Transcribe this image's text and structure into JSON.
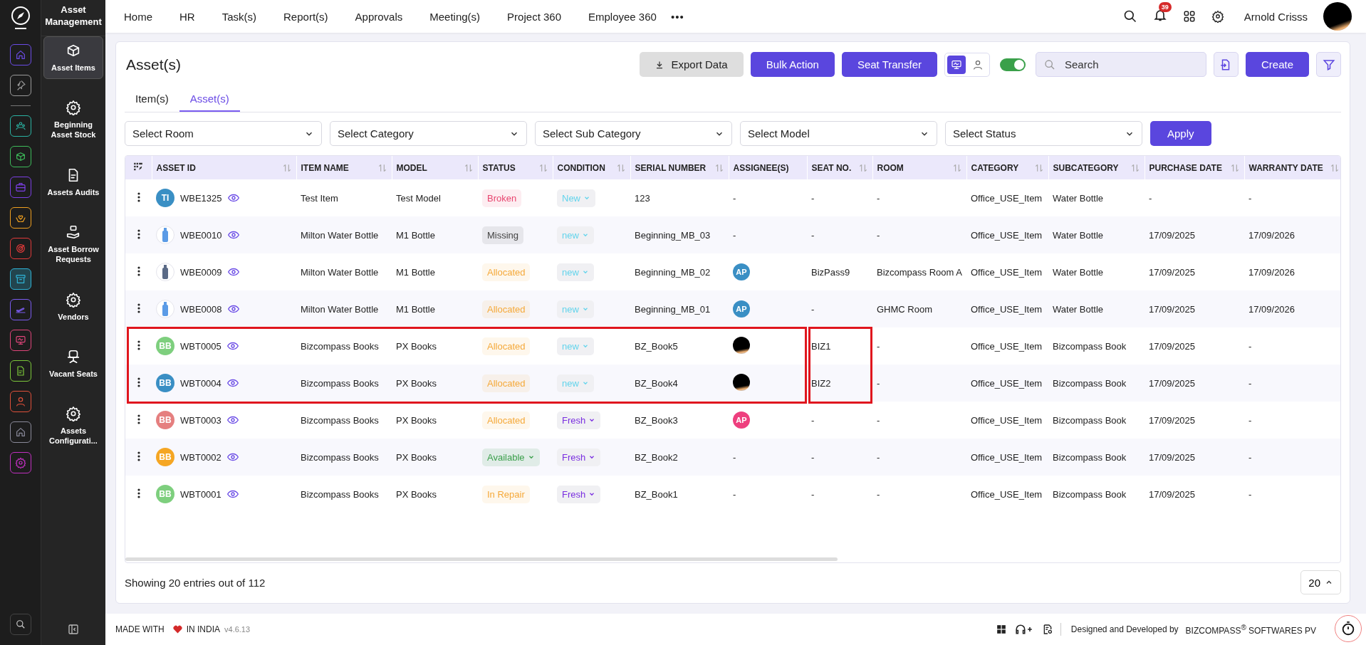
{
  "rail": {
    "pinned": [
      {
        "kind": "home",
        "color": "#6b4ce6",
        "selected": false
      },
      {
        "kind": "pin",
        "color": "#9a9a9a",
        "selected": false
      }
    ],
    "apps": [
      {
        "kind": "people",
        "color": "#2bb3a3",
        "selected": false
      },
      {
        "kind": "box",
        "color": "#3dbb5a",
        "selected": false
      },
      {
        "kind": "briefcase",
        "color": "#7b3fe4",
        "selected": false
      },
      {
        "kind": "hands",
        "color": "#f0a020",
        "selected": false
      },
      {
        "kind": "target",
        "color": "#e03a3a",
        "selected": false
      },
      {
        "kind": "archive",
        "color": "#2fb3d6",
        "selected": true
      },
      {
        "kind": "plane",
        "color": "#7b5cf0",
        "selected": false
      },
      {
        "kind": "monitor",
        "color": "#e0457a",
        "selected": false
      },
      {
        "kind": "document",
        "color": "#7cc83a",
        "selected": false
      },
      {
        "kind": "person",
        "color": "#e0503a",
        "selected": false
      },
      {
        "kind": "house",
        "color": "#8a8a9a",
        "selected": false
      },
      {
        "kind": "gear",
        "color": "#c030c0",
        "selected": false
      }
    ]
  },
  "sidebar": {
    "title": "Asset Management",
    "items": [
      {
        "label": "Asset Items",
        "kind": "box",
        "selected": true
      },
      {
        "label": "Beginning Asset Stock",
        "kind": "gear",
        "selected": false
      },
      {
        "label": "Assets Audits",
        "kind": "audit",
        "selected": false
      },
      {
        "label": "Asset Borrow Requests",
        "kind": "borrow",
        "selected": false
      },
      {
        "label": "Vendors",
        "kind": "gear",
        "selected": false
      },
      {
        "label": "Vacant Seats",
        "kind": "chair",
        "selected": false
      },
      {
        "label": "Assets Configurati...",
        "kind": "gear",
        "selected": false
      }
    ]
  },
  "nav": {
    "items": [
      "Home",
      "HR",
      "Task(s)",
      "Report(s)",
      "Approvals",
      "Meeting(s)",
      "Project 360",
      "Employee 360"
    ],
    "more": "•••",
    "notifications": "39",
    "user": "Arnold Crisss"
  },
  "page": {
    "title": "Asset(s)",
    "export": "Export Data",
    "bulk": "Bulk Action",
    "seat_transfer": "Seat Transfer",
    "views": [
      {
        "kind": "devices",
        "selected": true
      },
      {
        "kind": "person",
        "selected": false
      }
    ],
    "switch_on": true,
    "search": {
      "placeholder": "Search"
    },
    "create": "Create"
  },
  "tabs": [
    {
      "label": "Item(s)",
      "selected": false
    },
    {
      "label": "Asset(s)",
      "selected": true
    }
  ],
  "filters": [
    "Select Room",
    "Select Category",
    "Select Sub Category",
    "Select Model",
    "Select Status"
  ],
  "apply": "Apply",
  "table": {
    "columns": [
      {
        "label": "ASSET ID",
        "sortable": true
      },
      {
        "label": "ITEM NAME",
        "sortable": true
      },
      {
        "label": "MODEL",
        "sortable": true
      },
      {
        "label": "STATUS",
        "sortable": true
      },
      {
        "label": "CONDITION",
        "sortable": true
      },
      {
        "label": "SERIAL NUMBER",
        "sortable": true
      },
      {
        "label": "ASSIGNEE(S)",
        "sortable": false
      },
      {
        "label": "SEAT NO.",
        "sortable": true
      },
      {
        "label": "ROOM",
        "sortable": true
      },
      {
        "label": "CATEGORY",
        "sortable": true
      },
      {
        "label": "SUBCATEGORY",
        "sortable": true
      },
      {
        "label": "PURCHASE DATE",
        "sortable": true
      },
      {
        "label": "WARRANTY DATE",
        "sortable": true
      }
    ],
    "rows": [
      {
        "avatar": {
          "kind": "initials",
          "text": "TI",
          "color": "#3a8fc4"
        },
        "asset_id": "WBE1325",
        "item_name": "Test Item",
        "model": "Test Model",
        "status": {
          "label": "Broken",
          "color": "#e8446e",
          "kind": "label"
        },
        "condition": {
          "label": "New",
          "color": "#63d4ec"
        },
        "serial": "123",
        "assignee": {
          "kind": "none",
          "text": "-"
        },
        "seat": "-",
        "room": "-",
        "category": "Office_USE_Item",
        "subcategory": "Water Bottle",
        "purchase": "-",
        "warranty": "-"
      },
      {
        "avatar": {
          "kind": "bottle",
          "color": "#5b9be6"
        },
        "asset_id": "WBE0010",
        "item_name": "Milton Water Bottle",
        "model": "M1 Bottle",
        "status": {
          "label": "Missing",
          "color": "#444444",
          "kind": "label"
        },
        "condition": {
          "label": "new",
          "color": "#63d4ec"
        },
        "serial": "Beginning_MB_03",
        "assignee": {
          "kind": "none",
          "text": "-"
        },
        "seat": "-",
        "room": "-",
        "category": "Office_USE_Item",
        "subcategory": "Water Bottle",
        "purchase": "17/09/2025",
        "warranty": "17/09/2026"
      },
      {
        "avatar": {
          "kind": "bottle",
          "color": "#5a6a86"
        },
        "asset_id": "WBE0009",
        "item_name": "Milton Water Bottle",
        "model": "M1 Bottle",
        "status": {
          "label": "Allocated",
          "color": "#f5a93a",
          "kind": "label"
        },
        "condition": {
          "label": "new",
          "color": "#63d4ec"
        },
        "serial": "Beginning_MB_02",
        "assignee": {
          "kind": "initials",
          "text": "AP",
          "color": "#3a8fc4"
        },
        "seat": "BizPass9",
        "room": "Bizcompass Room A",
        "category": "Office_USE_Item",
        "subcategory": "Water Bottle",
        "purchase": "17/09/2025",
        "warranty": "17/09/2026"
      },
      {
        "avatar": {
          "kind": "bottle",
          "color": "#5b9be6"
        },
        "asset_id": "WBE0008",
        "item_name": "Milton Water Bottle",
        "model": "M1 Bottle",
        "status": {
          "label": "Allocated",
          "color": "#f5a93a",
          "kind": "label"
        },
        "condition": {
          "label": "new",
          "color": "#63d4ec"
        },
        "serial": "Beginning_MB_01",
        "assignee": {
          "kind": "initials",
          "text": "AP",
          "color": "#3a8fc4"
        },
        "seat": "-",
        "room": "GHMC Room",
        "category": "Office_USE_Item",
        "subcategory": "Water Bottle",
        "purchase": "17/09/2025",
        "warranty": "17/09/2026"
      },
      {
        "avatar": {
          "kind": "initials",
          "text": "BB",
          "color": "#7ecf7e"
        },
        "asset_id": "WBT0005",
        "item_name": "Bizcompass Books",
        "model": "PX Books",
        "status": {
          "label": "Allocated",
          "color": "#f5a93a",
          "kind": "label"
        },
        "condition": {
          "label": "new",
          "color": "#63d4ec"
        },
        "serial": "BZ_Book5",
        "assignee": {
          "kind": "photo"
        },
        "seat": "BIZ1",
        "room": "-",
        "category": "Office_USE_Item",
        "subcategory": "Bizcompass Book",
        "purchase": "17/09/2025",
        "warranty": "-"
      },
      {
        "avatar": {
          "kind": "initials",
          "text": "BB",
          "color": "#3a8fc4"
        },
        "asset_id": "WBT0004",
        "item_name": "Bizcompass Books",
        "model": "PX Books",
        "status": {
          "label": "Allocated",
          "color": "#f5a93a",
          "kind": "label"
        },
        "condition": {
          "label": "new",
          "color": "#63d4ec"
        },
        "serial": "BZ_Book4",
        "assignee": {
          "kind": "photo"
        },
        "seat": "BIZ2",
        "room": "-",
        "category": "Office_USE_Item",
        "subcategory": "Bizcompass Book",
        "purchase": "17/09/2025",
        "warranty": "-"
      },
      {
        "avatar": {
          "kind": "initials",
          "text": "BB",
          "color": "#e57f7f"
        },
        "asset_id": "WBT0003",
        "item_name": "Bizcompass Books",
        "model": "PX Books",
        "status": {
          "label": "Allocated",
          "color": "#f5a93a",
          "kind": "label"
        },
        "condition": {
          "label": "Fresh",
          "color": "#7a2fe0"
        },
        "serial": "BZ_Book3",
        "assignee": {
          "kind": "initials",
          "text": "AP",
          "color": "#ee3f7e"
        },
        "seat": "-",
        "room": "-",
        "category": "Office_USE_Item",
        "subcategory": "Bizcompass Book",
        "purchase": "17/09/2025",
        "warranty": "-"
      },
      {
        "avatar": {
          "kind": "initials",
          "text": "BB",
          "color": "#f5a623"
        },
        "asset_id": "WBT0002",
        "item_name": "Bizcompass Books",
        "model": "PX Books",
        "status": {
          "label": "Available",
          "color": "#3a9f4a",
          "kind": "dropdown"
        },
        "condition": {
          "label": "Fresh",
          "color": "#7a2fe0"
        },
        "serial": "BZ_Book2",
        "assignee": {
          "kind": "none",
          "text": "-"
        },
        "seat": "-",
        "room": "-",
        "category": "Office_USE_Item",
        "subcategory": "Bizcompass Book",
        "purchase": "17/09/2025",
        "warranty": "-"
      },
      {
        "avatar": {
          "kind": "initials",
          "text": "BB",
          "color": "#7ecf7e"
        },
        "asset_id": "WBT0001",
        "item_name": "Bizcompass Books",
        "model": "PX Books",
        "status": {
          "label": "In Repair",
          "color": "#f5a93a",
          "kind": "label"
        },
        "condition": {
          "label": "Fresh",
          "color": "#7a2fe0"
        },
        "serial": "BZ_Book1",
        "assignee": {
          "kind": "none",
          "text": "-"
        },
        "seat": "-",
        "room": "-",
        "category": "Office_USE_Item",
        "subcategory": "Bizcompass Book",
        "purchase": "17/09/2025",
        "warranty": "-"
      }
    ]
  },
  "highlighted_rows": [
    false,
    false,
    false,
    false,
    true,
    true,
    false,
    false,
    false
  ],
  "entries": "Showing 20 entries out of 112",
  "page_size": "20",
  "footer": {
    "made_with": "MADE WITH",
    "in_india": "IN INDIA",
    "version": "v4.6.13",
    "designed": "Designed and Developed by",
    "company": "BIZCOMPASS$^{®}$ SOFTWARES PV"
  }
}
